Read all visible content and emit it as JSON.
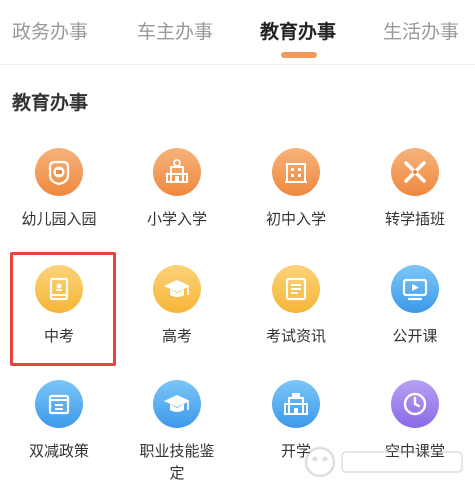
{
  "tabs": [
    {
      "label": "政务办事",
      "active": false
    },
    {
      "label": "车主办事",
      "active": false
    },
    {
      "label": "教育办事",
      "active": true
    },
    {
      "label": "生活办事",
      "active": false
    }
  ],
  "section": {
    "title": "教育办事"
  },
  "services": [
    {
      "label": "幼儿园入园",
      "icon": "kindergarten-badge-icon",
      "color": "#ef8840"
    },
    {
      "label": "小学入学",
      "icon": "school-building-icon",
      "color": "#ef8840"
    },
    {
      "label": "初中入学",
      "icon": "school-building-icon",
      "color": "#ef8840"
    },
    {
      "label": "转学插班",
      "icon": "pencil-ruler-icon",
      "color": "#ef8840"
    },
    {
      "label": "中考",
      "icon": "exam-book-icon",
      "color": "#f6b537"
    },
    {
      "label": "高考",
      "icon": "graduation-cap-icon",
      "color": "#f6b537"
    },
    {
      "label": "考试资讯",
      "icon": "news-document-icon",
      "color": "#f6b537"
    },
    {
      "label": "公开课",
      "icon": "video-play-icon",
      "color": "#3d99ea"
    },
    {
      "label": "双减政策",
      "icon": "policy-document-icon",
      "color": "#3d99ea"
    },
    {
      "label": "职业技能鉴定",
      "icon": "graduation-cap-icon",
      "color": "#3d99ea"
    },
    {
      "label": "开学",
      "icon": "school-building-icon",
      "color": "#3d99ea"
    },
    {
      "label": "空中课堂",
      "icon": "clock-icon",
      "color": "#8a6ae6"
    }
  ],
  "highlight": {
    "target": "中考",
    "color": "#e5443a"
  },
  "watermark": {
    "icon": "baidu-jingyan-watermark-icon"
  },
  "colors": {
    "accent": "#f29a5c",
    "active_tab": "#222222",
    "inactive_tab": "#999999"
  }
}
